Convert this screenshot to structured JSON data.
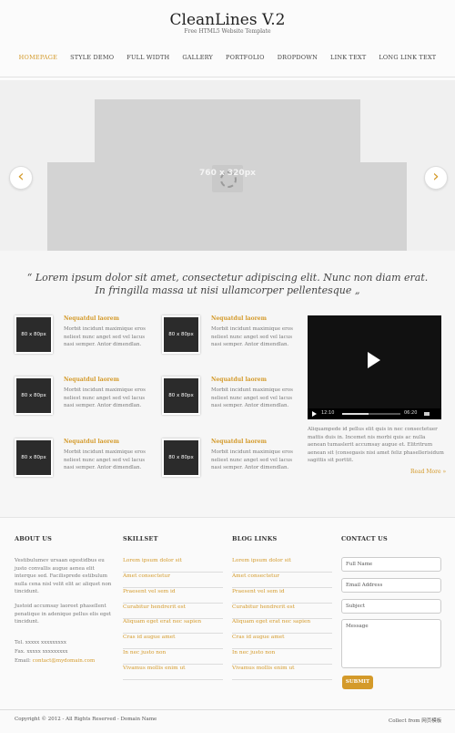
{
  "header": {
    "title": "CleanLines V.2",
    "subtitle": "Free HTML5 Website Template"
  },
  "nav": {
    "items": [
      "HOMEPAGE",
      "STYLE DEMO",
      "FULL WIDTH",
      "GALLERY",
      "PORTFOLIO",
      "DROPDOWN",
      "LINK TEXT",
      "LONG LINK TEXT"
    ],
    "active": "HOMEPAGE"
  },
  "slider": {
    "placeholder_label": "760 x 320px",
    "prev_icon": "chevron-left-icon",
    "next_icon": "chevron-right-icon"
  },
  "quote": {
    "line1": "“ Lorem ipsum dolor sit amet, consectetur adipiscing elit. Nunc non diam erat.",
    "line2": "In fringilla massa ut nisi ullamcorper pellentesque „"
  },
  "features": [
    {
      "thumb": "80 x 80px",
      "title": "Nequatdul laorem",
      "text": "Morbit incidunt maximique eros neliest nunc anget sed vel lacus nasi semper. Antor dimendlan."
    },
    {
      "thumb": "80 x 80px",
      "title": "Nequatdul laorem",
      "text": "Morbit incidunt maximique eros neliest nunc anget sed vel lacus nasi semper. Antor dimendlan."
    },
    {
      "thumb": "80 x 80px",
      "title": "Nequatdul laorem",
      "text": "Morbit incidunt maximique eros neliest nunc anget sed vel lacus nasi semper. Antor dimendlan."
    },
    {
      "thumb": "80 x 80px",
      "title": "Nequatdul laorem",
      "text": "Morbit incidunt maximique eros neliest nunc anget sed vel lacus nasi semper. Antor dimendlan."
    },
    {
      "thumb": "80 x 80px",
      "title": "Nequatdul laorem",
      "text": "Morbit incidunt maximique eros neliest nunc anget sed vel lacus nasi semper. Antor dimendlan."
    },
    {
      "thumb": "80 x 80px",
      "title": "Nequatdul laorem",
      "text": "Morbit incidunt maximique eros neliest nunc anget sed vel lacus nasi semper. Antor dimendlan."
    }
  ],
  "video": {
    "current_time": "12:10",
    "duration": "06:20",
    "progress": 0.45,
    "text": "Aliquampede id pellus elit quis in nec consectetuer mattis duis in. Incemet nis morbi quis ac nulla aenean tumaslerit accumsay augue et. Elitritrum aenean sit (consegasis nisi amet feliz phasellerisidum sagittis sit porttit.",
    "read_more": "Read More »"
  },
  "footer": {
    "about": {
      "title": "ABOUT US",
      "para1": "Vestibulumev ursaan egestidbus eu justo convallis augue aenea elit interque sed. Facilisprede estibulum nulla cena nisl velit elit ac aliquet non tincidunt.",
      "para2": "Justoid accumsay laoreet phasellent penatique in adenique pellus elis eget tincidunt.",
      "tel": "Tel. xxxxx xxxxxxxxx",
      "fax": "Fax. xxxxx xxxxxxxxx",
      "email_label": "Email:",
      "email": "contact@mydomain.com"
    },
    "skillset": {
      "title": "SKILLSET",
      "links": [
        "Lorem ipsum dolor sit",
        "Amet consectetur",
        "Praesent vel sem id",
        "Curabitur hendrerit est",
        "Aliquam eget erat nec sapien",
        "Cras id augue amet",
        "In nec justo non",
        "Vivamus mollis enim ut"
      ]
    },
    "blog": {
      "title": "BLOG LINKS",
      "links": [
        "Lorem ipsum dolor sit",
        "Amet consectetur",
        "Praesent vel sem id",
        "Curabitur hendrerit est",
        "Aliquam eget erat nec sapien",
        "Cras id augue amet",
        "In nec justo non",
        "Vivamus mollis enim ut"
      ]
    },
    "contact": {
      "title": "CONTACT US",
      "full_name": "Full Name",
      "email": "Email Address",
      "subject": "Subject",
      "message": "Message",
      "submit": "SUBMIT"
    },
    "copyright": "Copyright © 2012 - All Rights Reserved - Domain Name",
    "credit": "Collect from 网页模板"
  },
  "colors": {
    "accent": "#d49a2a",
    "thumb_bg": "#2b2b2b",
    "slide_placeholder": "#d3d3d3"
  }
}
